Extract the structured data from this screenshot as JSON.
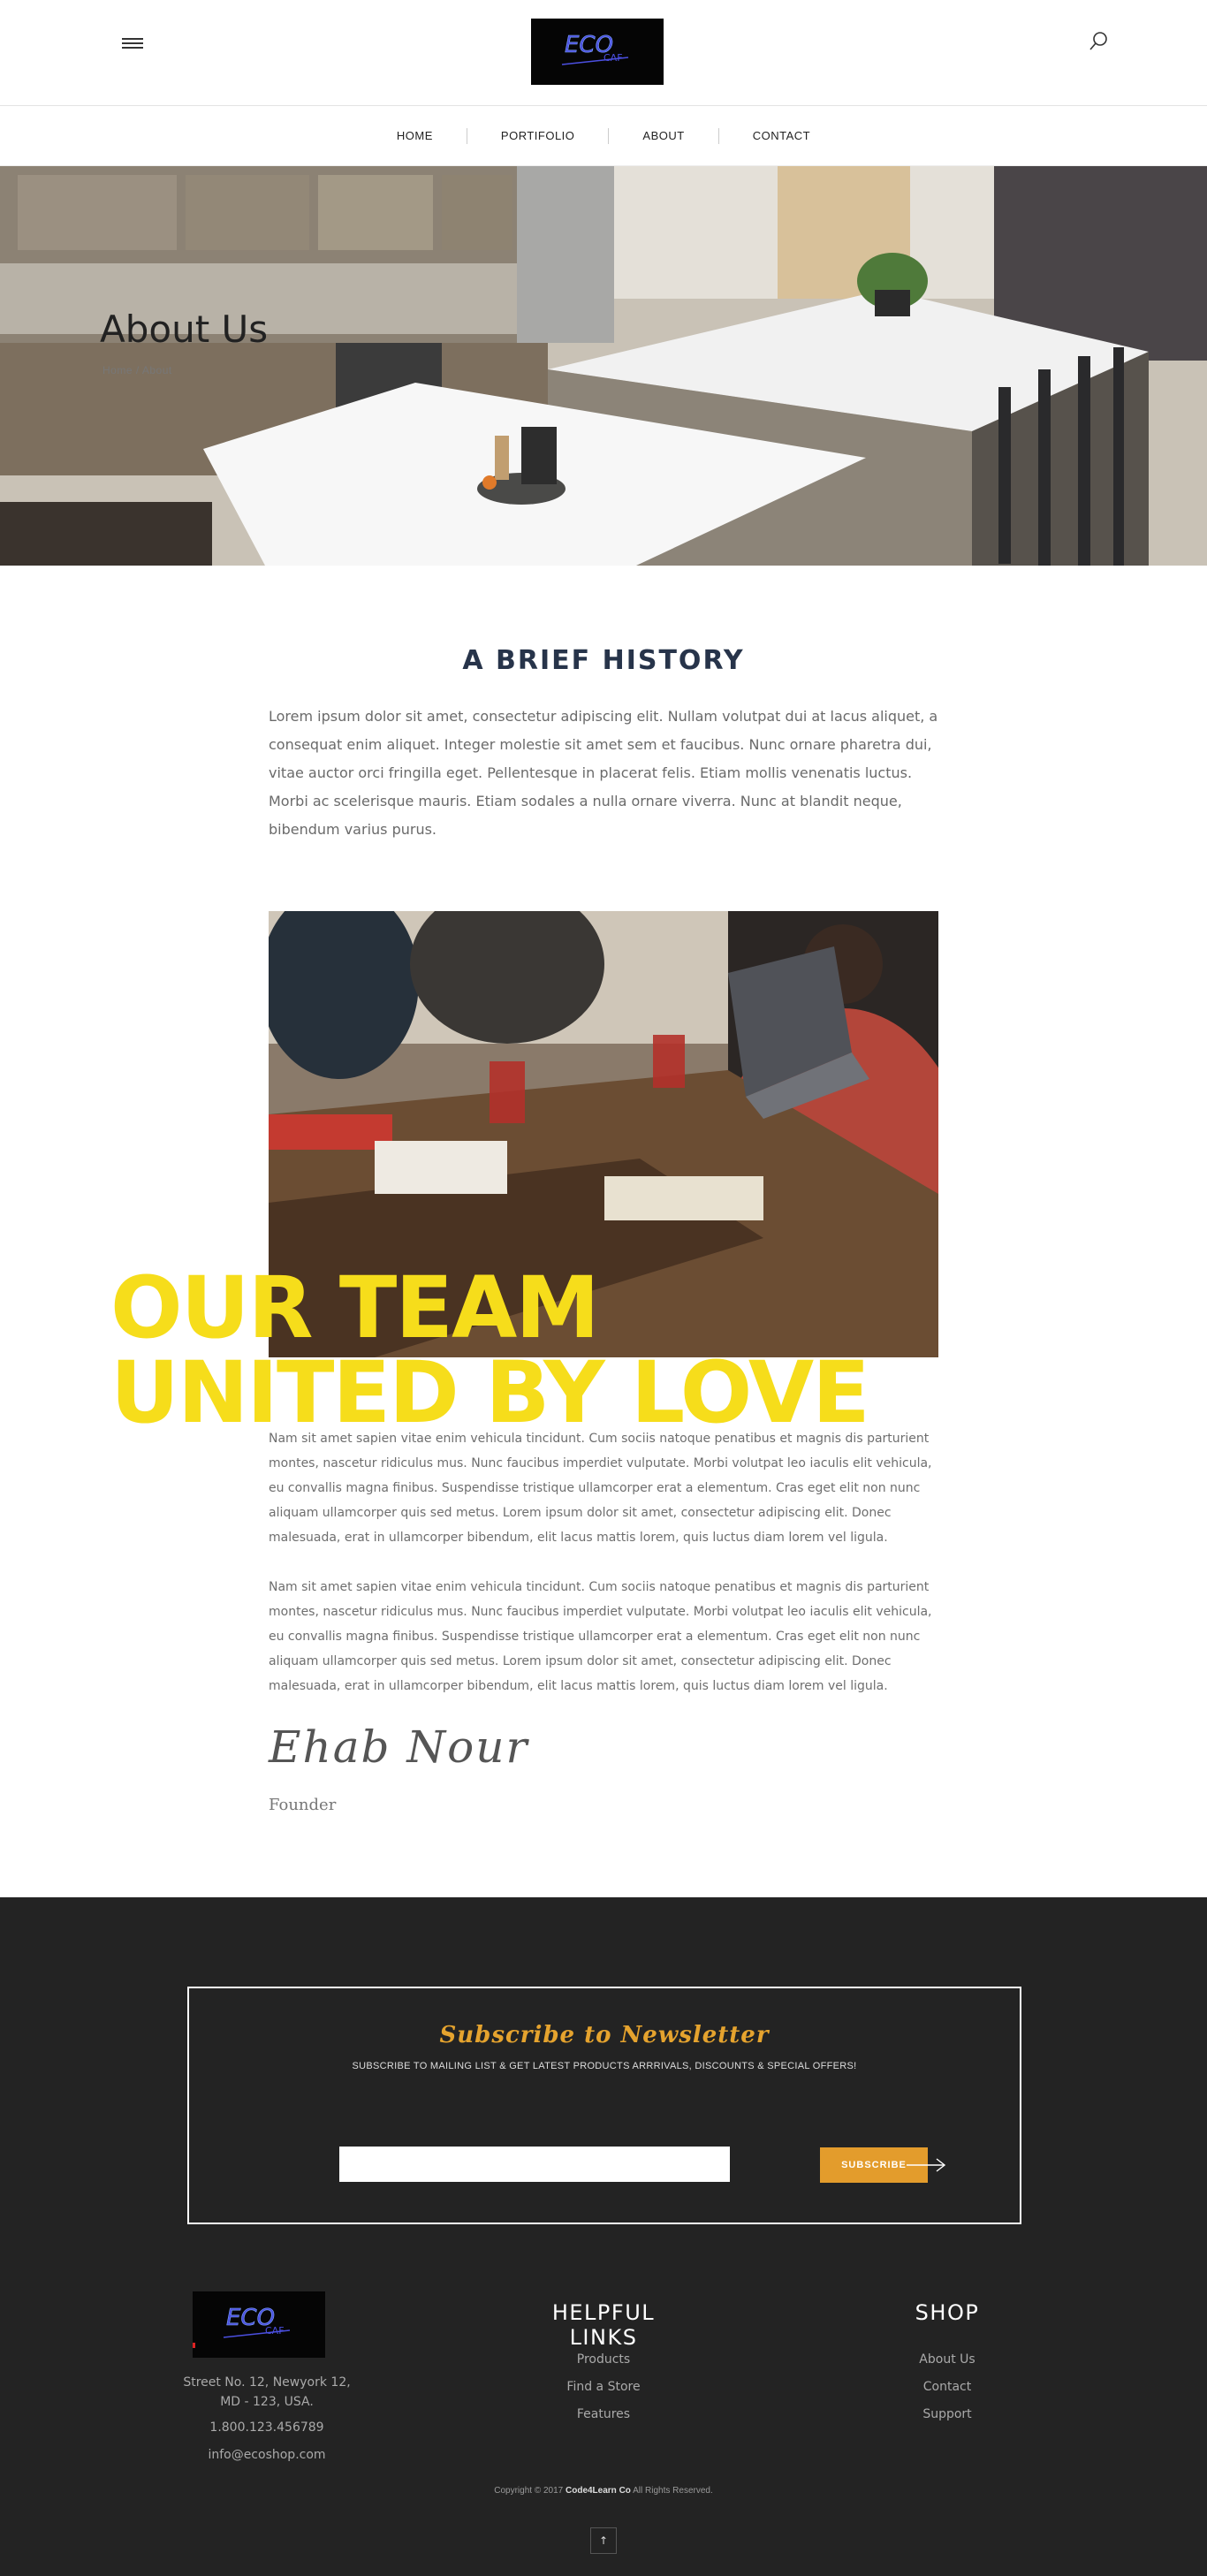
{
  "header": {
    "menu_icon": "hamburger-menu-icon",
    "logo_text": "ECO",
    "logo_sub": "CAF",
    "search_icon": "search-icon"
  },
  "nav": {
    "items": [
      "HOME",
      "PORTIFOLIO",
      "ABOUT",
      "CONTACT"
    ]
  },
  "hero": {
    "title": "About Us",
    "breadcrumb": "Home / About"
  },
  "history": {
    "title": "A BRIEF HISTORY",
    "text": "Lorem ipsum dolor sit amet, consectetur adipiscing elit. Nullam volutpat dui at lacus aliquet, a consequat enim aliquet. Integer molestie sit amet sem et faucibus. Nunc ornare pharetra dui, vitae auctor orci fringilla eget. Pellentesque in placerat felis. Etiam mollis venenatis luctus. Morbi ac scelerisque mauris. Etiam sodales a nulla ornare viverra. Nunc at blandit neque, bibendum varius purus."
  },
  "team": {
    "heading_line1": "OUR TEAM",
    "heading_line2": "UNITED BY LOVE",
    "paragraph1": "Nam sit amet sapien vitae enim vehicula tincidunt. Cum sociis natoque penatibus et magnis dis parturient montes, nascetur ridiculus mus. Nunc faucibus imperdiet vulputate. Morbi volutpat leo iaculis elit vehicula, eu convallis magna finibus. Suspendisse tristique ullamcorper erat a elementum. Cras eget elit non nunc aliquam ullamcorper quis sed metus. Lorem ipsum dolor sit amet, consectetur adipiscing elit. Donec malesuada, erat in ullamcorper bibendum, elit lacus mattis lorem, quis luctus diam lorem vel ligula.",
    "paragraph2": "Nam sit amet sapien vitae enim vehicula tincidunt. Cum sociis natoque penatibus et magnis dis parturient montes, nascetur ridiculus mus. Nunc faucibus imperdiet vulputate. Morbi volutpat leo iaculis elit vehicula, eu convallis magna finibus. Suspendisse tristique ullamcorper erat a elementum. Cras eget elit non nunc aliquam ullamcorper quis sed metus. Lorem ipsum dolor sit amet, consectetur adipiscing elit. Donec malesuada, erat in ullamcorper bibendum, elit lacus mattis lorem, quis luctus diam lorem vel ligula.",
    "signature": "Ehab Nour",
    "role": "Founder"
  },
  "newsletter": {
    "title": "Subscribe to Newsletter",
    "subtitle": "SUBSCRIBE TO MAILING LIST & GET LATEST PRODUCTS ARRRIVALS, DISCOUNTS & SPECIAL OFFERS!",
    "input_placeholder": "",
    "button_label": "SUBSCRIBE",
    "arrow_icon": "arrow-right-icon"
  },
  "footer": {
    "address": "Street No. 12, Newyork 12, MD - 123, USA.",
    "phone": "1.800.123.456789",
    "email": "info@ecoshop.com",
    "helpful_title": "HELPFUL LINKS",
    "helpful_links": [
      "Products",
      "Find a Store",
      "Features"
    ],
    "shop_title": "SHOP",
    "shop_links": [
      "About Us",
      "Contact",
      "Support"
    ],
    "copyright_prefix": "Copyright © 2017",
    "copyright_brand": "Code4Learn Co",
    "copyright_suffix": "All Rights Reserved.",
    "top_button": "↑"
  },
  "colors": {
    "accent_yellow": "#f6dd1b",
    "accent_orange": "#e39c2c",
    "footer_bg": "#232323",
    "history_title": "#27344a"
  }
}
